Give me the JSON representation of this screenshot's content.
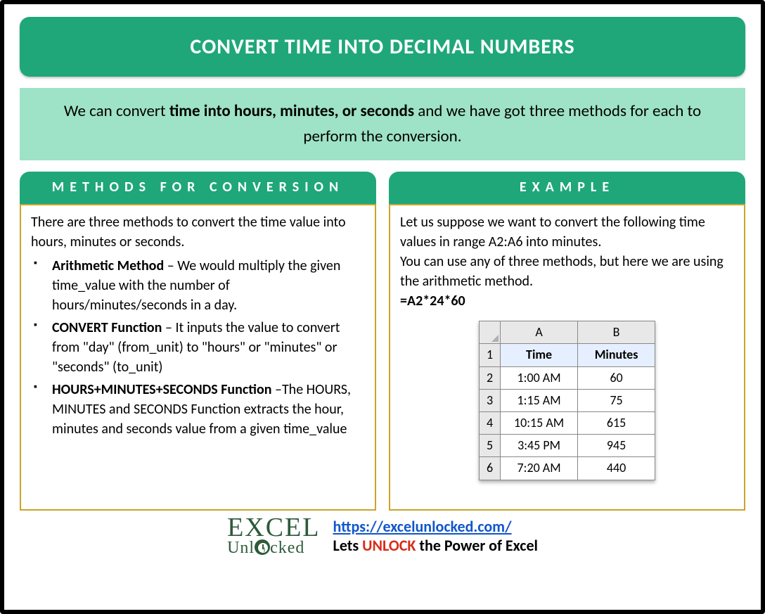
{
  "title": "CONVERT TIME INTO DECIMAL NUMBERS",
  "intro": {
    "pre": "We can convert ",
    "bold": "time into hours, minutes, or seconds",
    "post": " and we have got three methods for each to perform the conversion."
  },
  "left": {
    "header": "METHODS FOR CONVERSION",
    "lead": "There are three methods to convert the time value into hours, minutes or seconds.",
    "items": [
      {
        "name": "Arithmetic Method",
        "sep": " – ",
        "desc": "We would multiply the given time_value with the number of hours/minutes/seconds in a day."
      },
      {
        "name": "CONVERT Function",
        "sep": " – ",
        "desc": "It inputs the value to convert from \"day\" (from_unit) to \"hours\" or \"minutes\" or \"seconds\" (to_unit)"
      },
      {
        "name": "HOURS+MINUTES+SECONDS Function",
        "sep": " –",
        "desc": "The HOURS, MINUTES and SECONDS Function extracts the hour, minutes and seconds value from a given time_value"
      }
    ]
  },
  "right": {
    "header": "EXAMPLE",
    "p1": "Let us suppose we want to convert the following time values in range A2:A6 into minutes.",
    "p2": "You can use any of three methods, but here we are using the arithmetic method.",
    "formula": "=A2*24*60",
    "table": {
      "cols": [
        "A",
        "B"
      ],
      "headers": [
        "Time",
        "Minutes"
      ],
      "rows": [
        {
          "n": "1"
        },
        {
          "n": "2",
          "a": "1:00 AM",
          "b": "60"
        },
        {
          "n": "3",
          "a": "1:15 AM",
          "b": "75"
        },
        {
          "n": "4",
          "a": "10:15 AM",
          "b": "615"
        },
        {
          "n": "5",
          "a": "3:45 PM",
          "b": "945"
        },
        {
          "n": "6",
          "a": "7:20 AM",
          "b": "440"
        }
      ]
    }
  },
  "footer": {
    "logo1": "EXCEL",
    "logo2_pre": "Unl",
    "logo2_post": "cked",
    "url": "https://excelunlocked.com/",
    "tagline_pre": "Lets ",
    "tagline_bold": "UNLOCK",
    "tagline_post": " the Power of Excel"
  }
}
